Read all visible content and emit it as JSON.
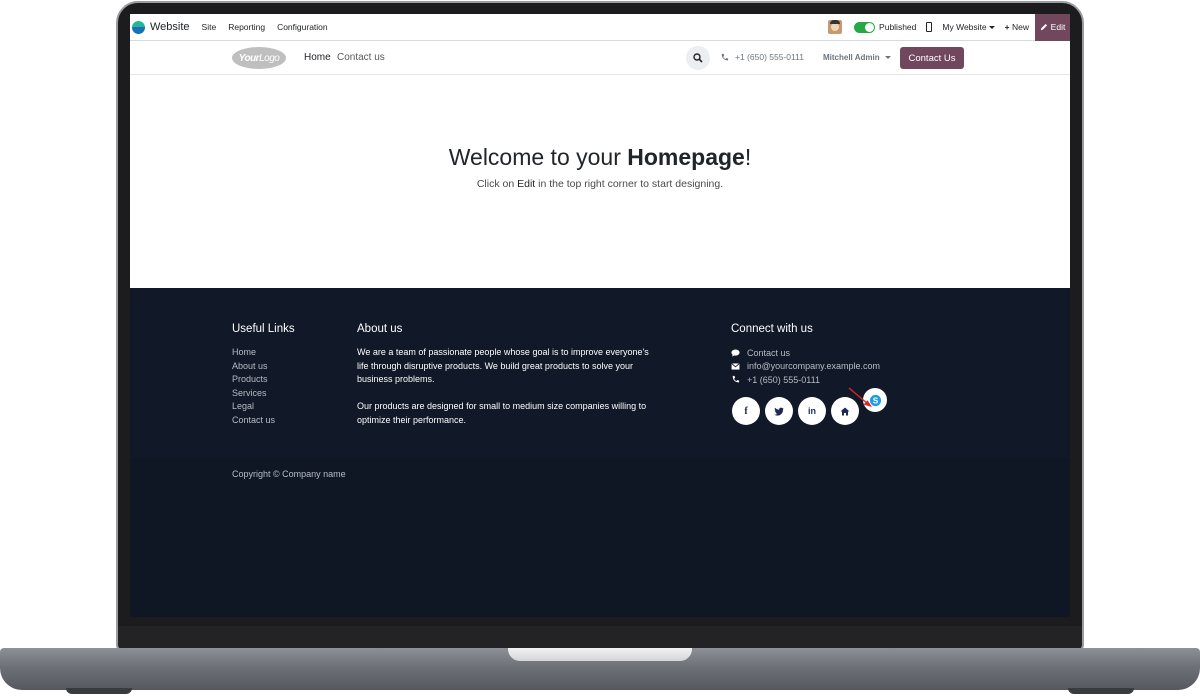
{
  "topbar": {
    "app_name": "Website",
    "menu": [
      "Site",
      "Reporting",
      "Configuration"
    ],
    "published_label": "Published",
    "my_website_label": "My Website",
    "new_label": "New",
    "edit_label": "Edit",
    "edit_color": "#71475e"
  },
  "header": {
    "logo_text_bold": "Your",
    "logo_text": "Logo",
    "nav": [
      "Home",
      "Contact us"
    ],
    "phone": "+1 (650) 555-0111",
    "user": "Mitchell Admin",
    "cta_label": "Contact Us",
    "cta_color": "#71475e"
  },
  "hero": {
    "title_prefix": "Welcome to your ",
    "title_bold": "Homepage",
    "title_suffix": "!",
    "sub_prefix": "Click on ",
    "sub_bold": "Edit",
    "sub_suffix": " in the top right corner to start designing."
  },
  "footer": {
    "useful_links_title": "Useful Links",
    "useful_links": [
      "Home",
      "About us",
      "Products",
      "Services",
      "Legal",
      "Contact us"
    ],
    "about_title": "About us",
    "about_p1": "We are a team of passionate people whose goal is to improve everyone's life through disruptive products. We build great products to solve your business problems.",
    "about_p2": "Our products are designed for small to medium size companies willing to optimize their performance.",
    "connect_title": "Connect with us",
    "connect_contact": "Contact us",
    "connect_email": "info@yourcompany.example.com",
    "connect_phone": "+1 (650) 555-0111",
    "social": [
      "facebook-icon",
      "twitter-icon",
      "linkedin-icon",
      "home-icon",
      "skype-icon"
    ],
    "background": "#111827"
  },
  "copyright": "Copyright © Company name"
}
